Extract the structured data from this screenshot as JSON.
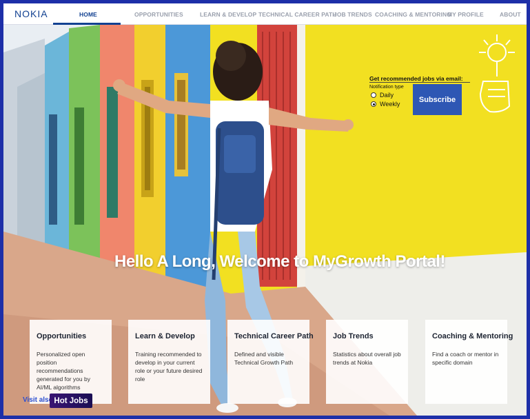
{
  "nav": {
    "logo": "NOKIA",
    "items": [
      "HOME",
      "OPPORTUNITIES",
      "LEARN & DEVELOP",
      "TECHNICAL CAREER PATH",
      "JOB TRENDS",
      "COACHING & MENTORING",
      "MY PROFILE",
      "ABOUT"
    ],
    "active": "HOME"
  },
  "subscribe": {
    "title": "Get recommended jobs via email:",
    "type_label": "Notification type",
    "options": [
      "Daily",
      "Weekly"
    ],
    "selected": "Weekly",
    "button_label": "Subscribe"
  },
  "welcome": "Hello A Long, Welcome to MyGrowth Portal!",
  "cards": [
    {
      "title": "Opportunities",
      "desc": "Personalized open position recommendations generated for you by AI/ML algorithms"
    },
    {
      "title": "Learn & Develop",
      "desc": "Training recommended to develop in your current role or your future desired role"
    },
    {
      "title": "Technical Career Path",
      "desc": "Defined and visible Technical Growth Path"
    },
    {
      "title": "Job Trends",
      "desc": "Statistics about overall job trends at Nokia"
    },
    {
      "title": "Coaching & Mentoring",
      "desc": "Find a coach or mentor in specific domain"
    }
  ],
  "hotjobs": {
    "visit_label": "Visit also",
    "button_label": "Hot Jobs"
  },
  "colors": {
    "brand": "#124191",
    "frame": "#1d2fa8",
    "subscribe": "#2e57b4",
    "wall_yellow": "#f2e021"
  },
  "icons": [
    "lightbulb-hand-icon"
  ]
}
